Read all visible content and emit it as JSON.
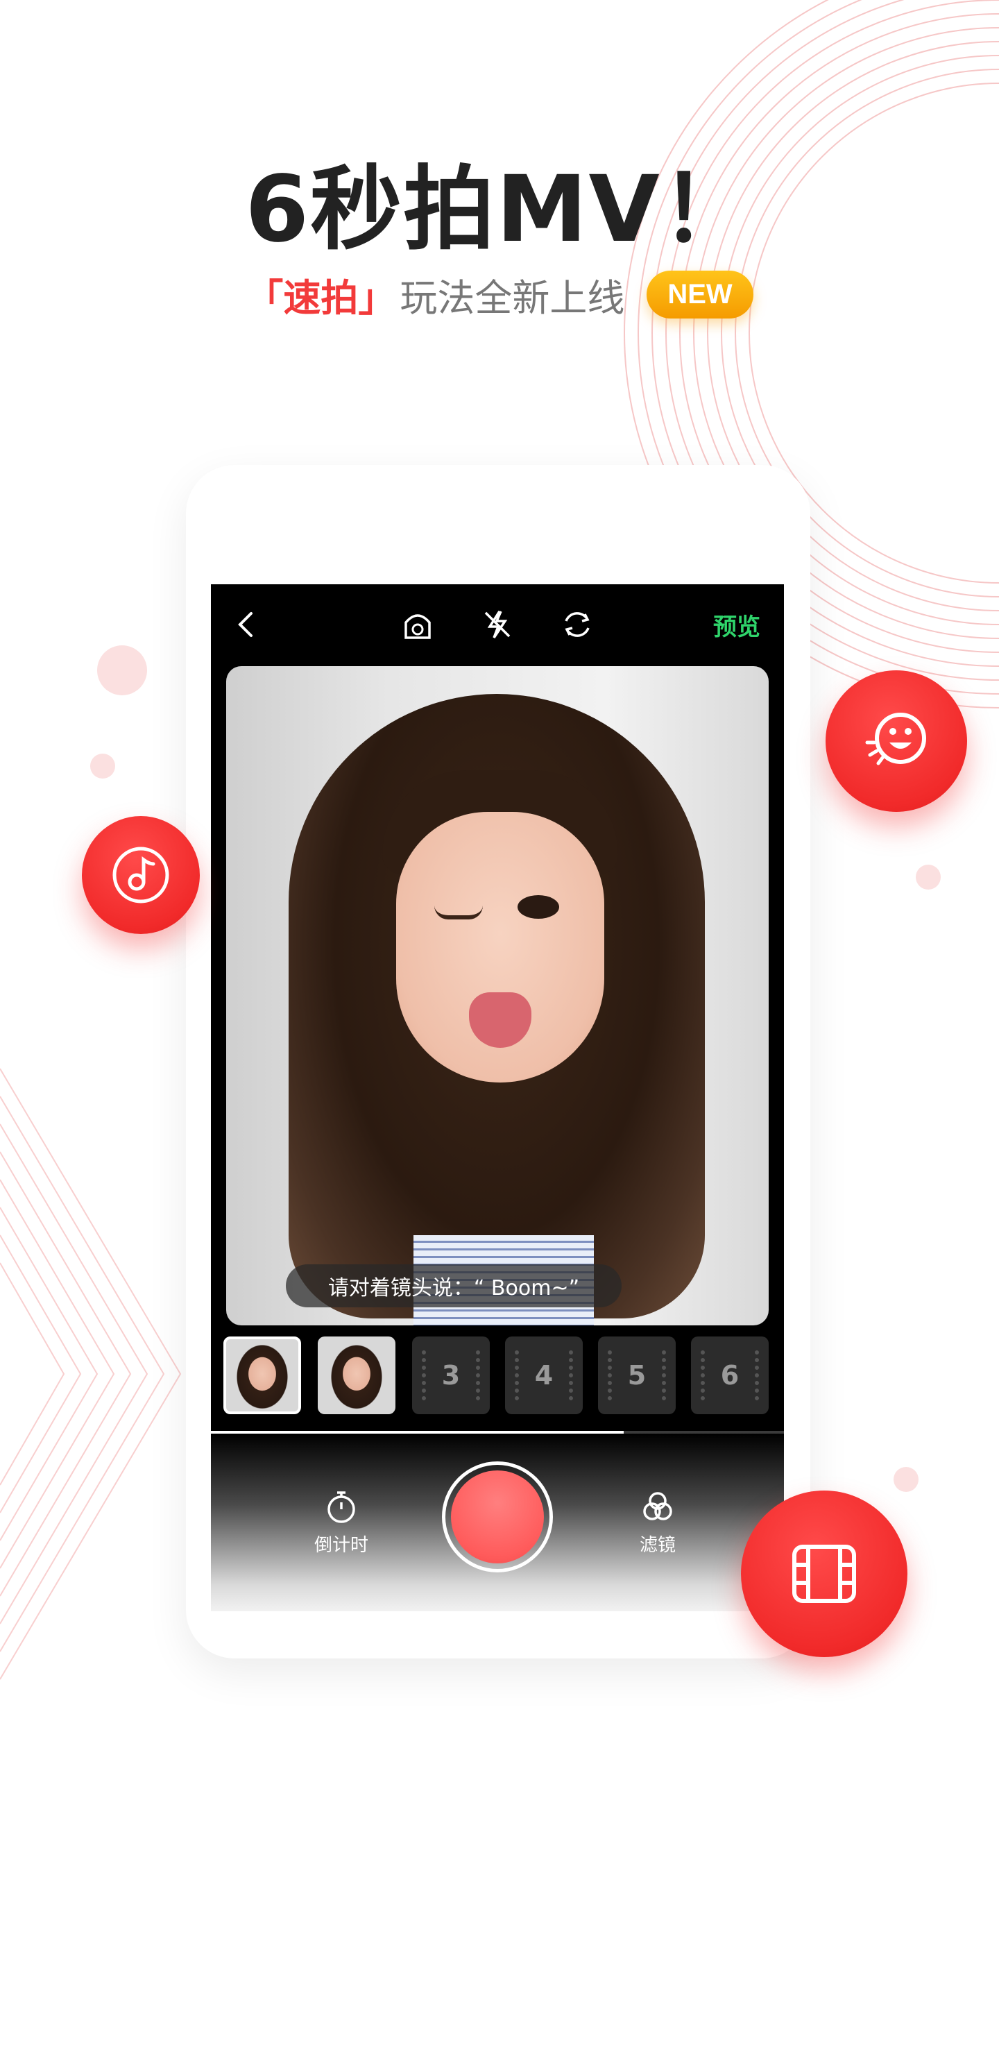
{
  "headline": "6秒拍MV！",
  "subline": {
    "accent": "「速拍」",
    "rest": "玩法全新上线",
    "badge": "NEW"
  },
  "camera": {
    "preview_label": "预览",
    "prompt": "请对着镜头说：“ Boom~”",
    "slots": [
      "3",
      "4",
      "5",
      "6"
    ],
    "recorded_clips": 2,
    "progress_fraction": 0.72,
    "timer_label": "倒计时",
    "filter_label": "滤镜"
  },
  "icons": {
    "back": "back-icon",
    "beauty": "beauty-icon",
    "flash": "flash-off-icon",
    "switch": "switch-camera-icon",
    "music": "music-icon",
    "sticker": "smiley-icon",
    "film": "film-icon"
  },
  "colors": {
    "accent_red": "#f23a3a",
    "preview_green": "#2fd46b",
    "badge_orange": "#f7a500"
  }
}
